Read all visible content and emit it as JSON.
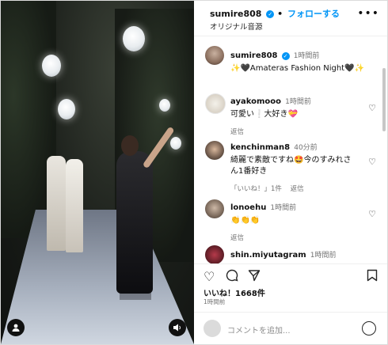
{
  "header": {
    "username": "sumire808",
    "follow_label": "フォローする",
    "dot": "•",
    "audio": "オリジナル音源",
    "more": "•••"
  },
  "caption": {
    "username": "sumire808",
    "time": "1時間前",
    "text": "✨🖤Amateras Fashion Night🖤✨"
  },
  "comments": [
    {
      "username": "ayakomooo",
      "time": "1時間前",
      "text": "可愛い❕大好き💝",
      "reply": "返信"
    },
    {
      "username": "kenchinman8",
      "time": "40分前",
      "text": "綺麗で素敵ですね🤩今のすみれさん1番好き",
      "likes": "「いいね！」1件",
      "reply": "返信"
    },
    {
      "username": "lonoehu",
      "time": "1時間前",
      "text": "👏👏👏",
      "reply": "返信"
    },
    {
      "username": "shin.miyutagram",
      "time": "1時間前",
      "text": ""
    }
  ],
  "likes": "いいね！1668件",
  "posted": "1時間前",
  "add_comment_placeholder": "コメントを追加...",
  "colors": {
    "link": "#0095f6",
    "border": "#efefef",
    "muted": "#737373"
  },
  "icons": [
    "verified-badge-icon",
    "more-icon",
    "heart-icon",
    "comment-icon",
    "share-icon",
    "save-icon",
    "emoji-icon",
    "user-icon",
    "audio-icon"
  ]
}
